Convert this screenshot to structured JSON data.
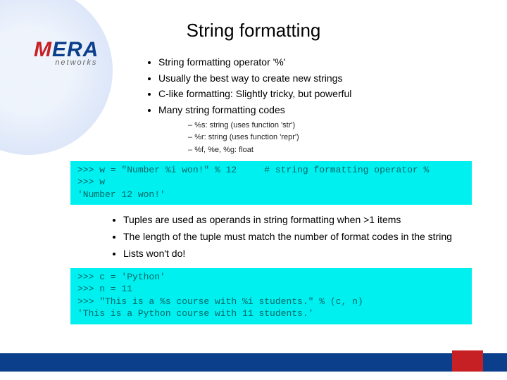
{
  "logo": {
    "brand_m": "M",
    "brand_era": "ERA",
    "tag": "networks"
  },
  "title": "String formatting",
  "bullets1": {
    "b0": "String formatting operator '%'",
    "b1": "Usually the best way to create new strings",
    "b2": "C-like formatting: Slightly tricky, but powerful",
    "b3": "Many string formatting codes",
    "sub0": "%s: string (uses function 'str')",
    "sub1": "%r: string (uses function 'repr')",
    "sub2": "%f, %e, %g: float"
  },
  "code1": ">>> w = \"Number %i won!\" % 12     # string formatting operator %\n>>> w\n'Number 12 won!'",
  "bullets2": {
    "b0": "Tuples are used as operands in string formatting when >1 items",
    "b1": "The length of the tuple must match the number of format codes in the string",
    "b2": "Lists won't do!"
  },
  "code2": ">>> c = 'Python'\n>>> n = 11\n>>> \"This is a %s course with %i students.\" % (c, n)\n'This is a Python course with 11 students.'"
}
